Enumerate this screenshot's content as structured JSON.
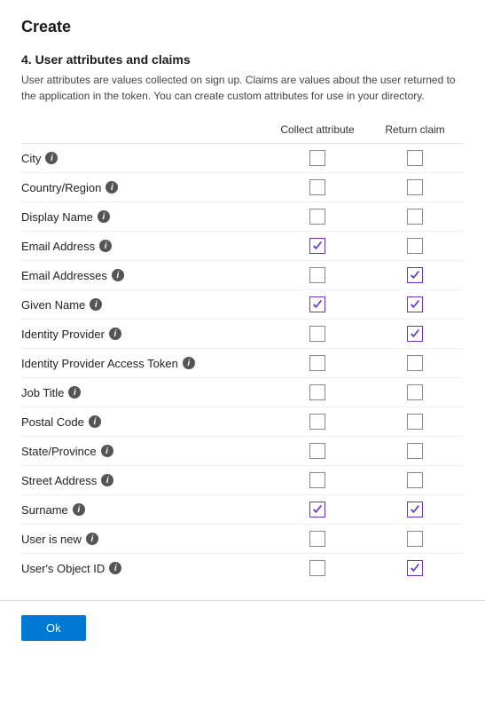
{
  "page": {
    "title": "Create",
    "section_number": "4. User attributes and claims",
    "section_desc": "User attributes are values collected on sign up. Claims are values about the user returned to the application in the token. You can create custom attributes for use in your directory.",
    "col_collect": "Collect attribute",
    "col_return": "Return claim",
    "ok_label": "Ok",
    "attributes": [
      {
        "name": "City",
        "collect": false,
        "return": false
      },
      {
        "name": "Country/Region",
        "collect": false,
        "return": false
      },
      {
        "name": "Display Name",
        "collect": false,
        "return": false
      },
      {
        "name": "Email Address",
        "collect": true,
        "return": false
      },
      {
        "name": "Email Addresses",
        "collect": false,
        "return": true
      },
      {
        "name": "Given Name",
        "collect": true,
        "return": true
      },
      {
        "name": "Identity Provider",
        "collect": false,
        "return": true
      },
      {
        "name": "Identity Provider Access Token",
        "collect": false,
        "return": false
      },
      {
        "name": "Job Title",
        "collect": false,
        "return": false
      },
      {
        "name": "Postal Code",
        "collect": false,
        "return": false
      },
      {
        "name": "State/Province",
        "collect": false,
        "return": false
      },
      {
        "name": "Street Address",
        "collect": false,
        "return": false
      },
      {
        "name": "Surname",
        "collect": true,
        "return": true
      },
      {
        "name": "User is new",
        "collect": false,
        "return": false
      },
      {
        "name": "User's Object ID",
        "collect": false,
        "return": true
      }
    ]
  }
}
